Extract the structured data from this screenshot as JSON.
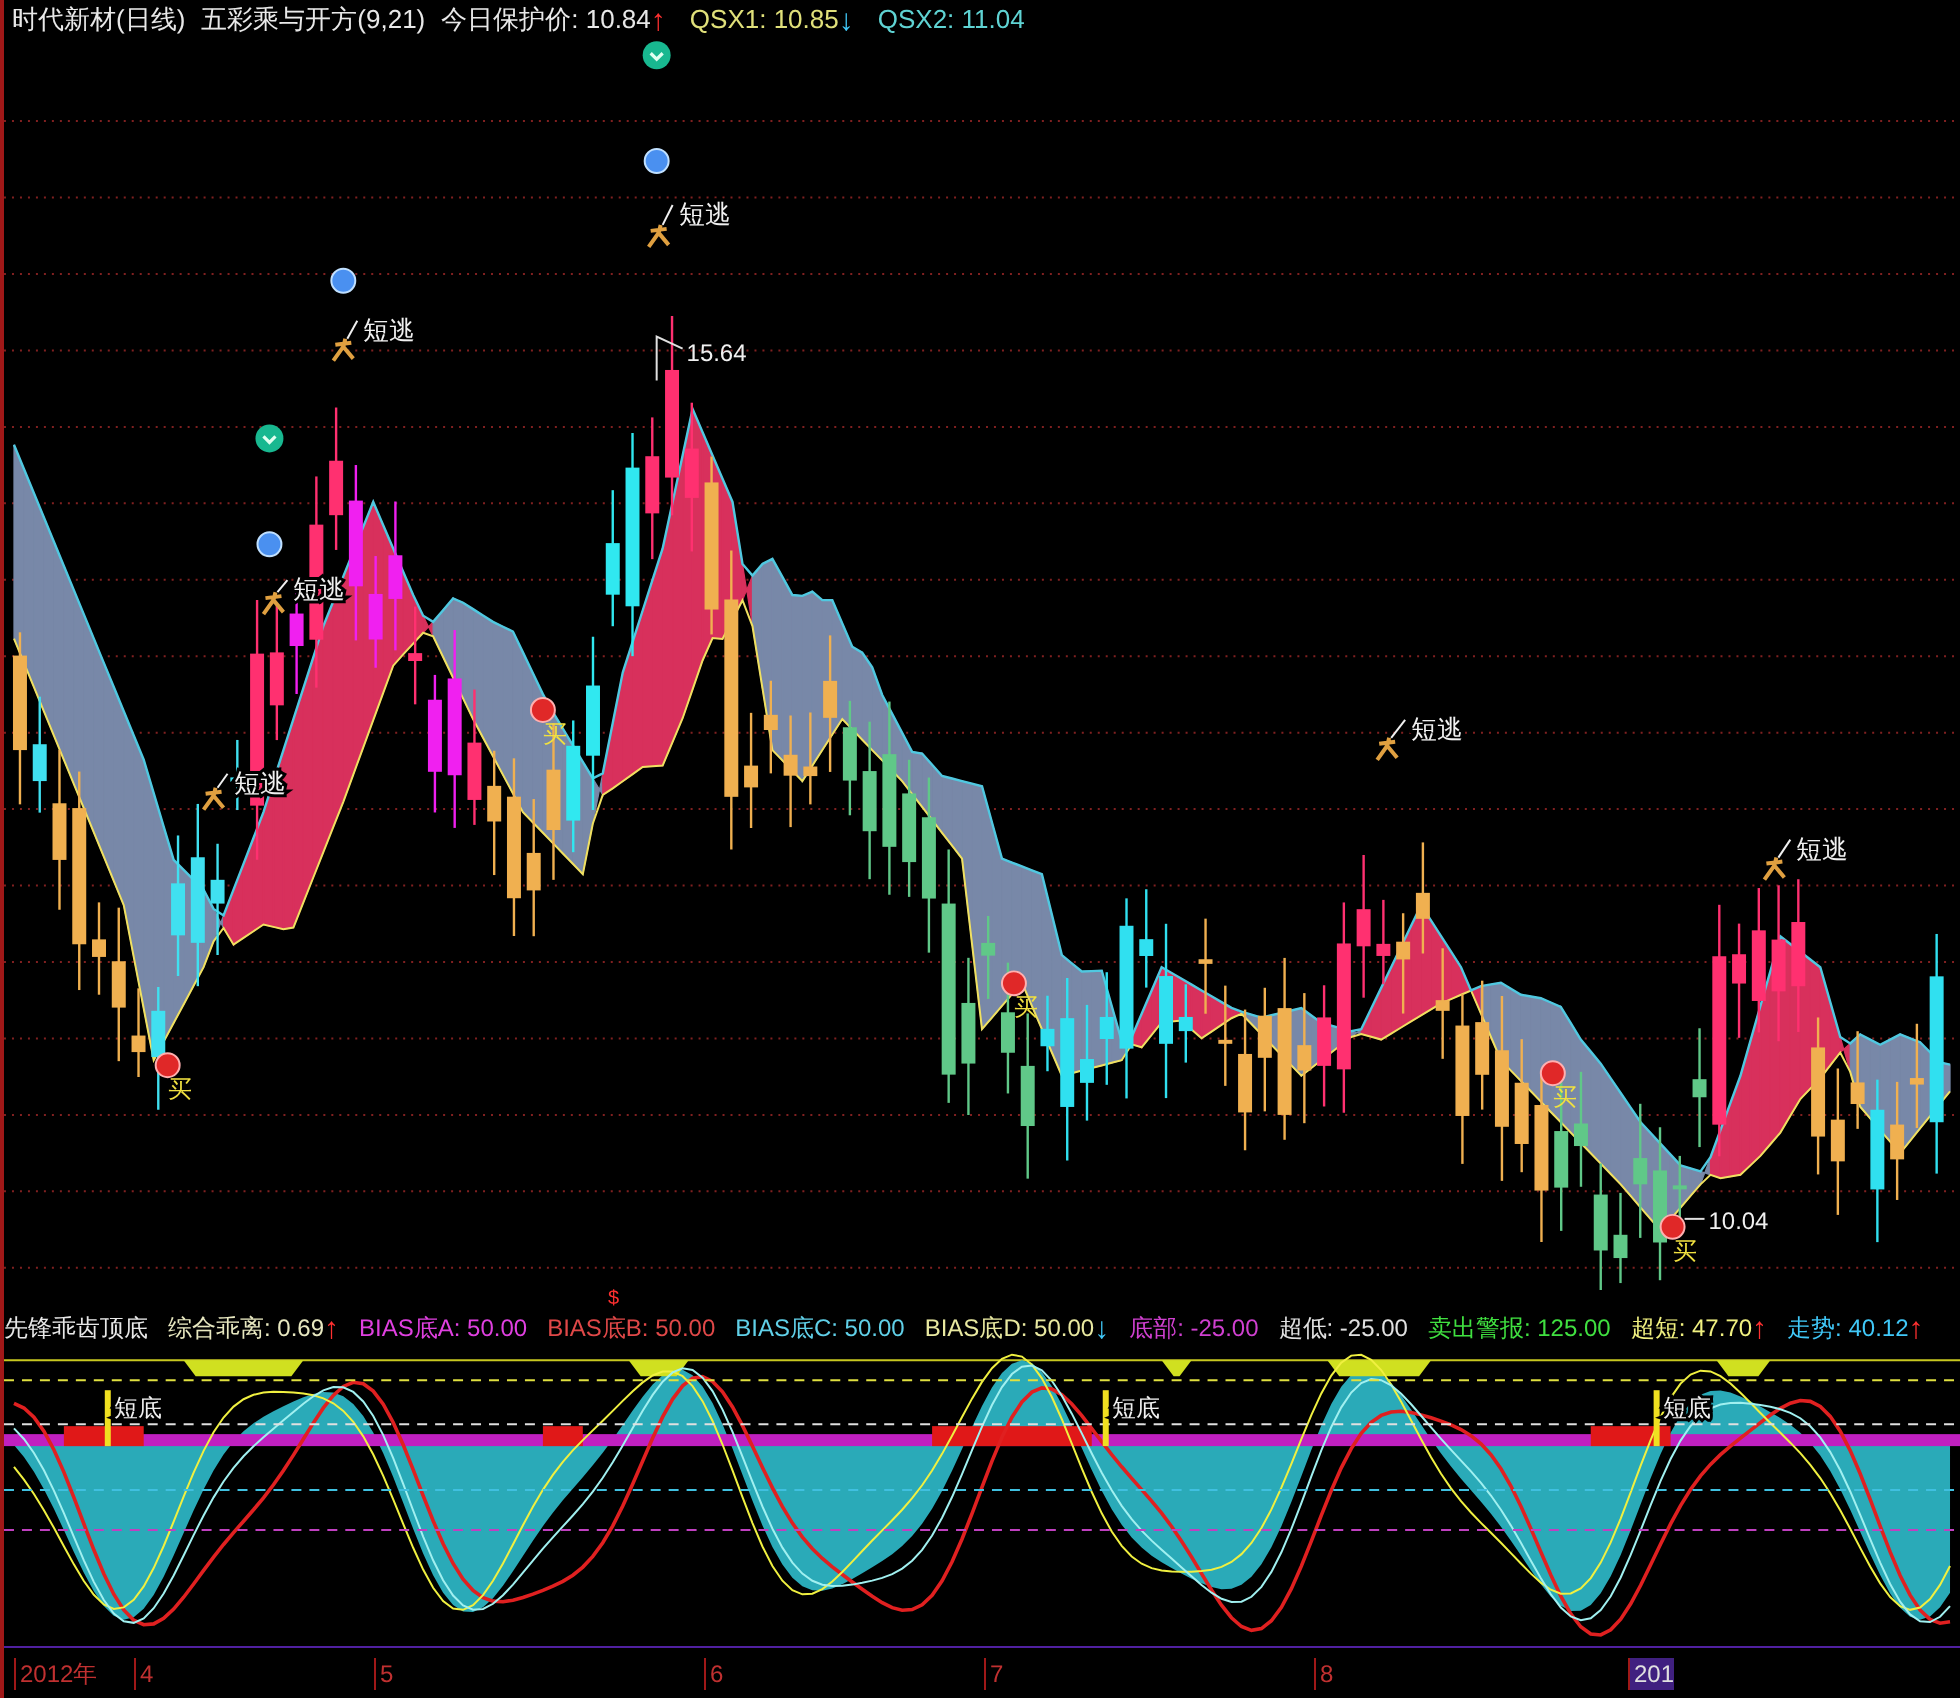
{
  "header": {
    "title": "时代新材(日线)",
    "indicator": "五彩乘与开方(9,21)",
    "readings": [
      {
        "text": "今日保护价: 10.84",
        "arrow": {
          "text": "↑",
          "color": "#ff3030"
        },
        "color": "#e8e8e8"
      },
      {
        "text": "QSX1: 10.85",
        "arrow": {
          "text": "↓",
          "color": "#40c8f8"
        },
        "color": "#e0e07a"
      },
      {
        "text": "QSX2: 11.04",
        "color": "#5fd3d3"
      }
    ]
  },
  "main_chart": {
    "annotations": [
      {
        "kind": "escape",
        "text": "短逃"
      },
      {
        "kind": "escape",
        "text": "短逃"
      },
      {
        "kind": "escape",
        "text": "短逃"
      },
      {
        "kind": "escape",
        "text": "短逃"
      },
      {
        "kind": "escape",
        "text": "短逃"
      },
      {
        "kind": "escape",
        "text": "短逃"
      },
      {
        "kind": "buy",
        "text": "买"
      },
      {
        "kind": "buy",
        "text": "买"
      },
      {
        "kind": "buy",
        "text": "买"
      },
      {
        "kind": "buy",
        "text": "买"
      },
      {
        "kind": "buy",
        "text": "买"
      },
      {
        "kind": "high",
        "text": "15.64"
      },
      {
        "kind": "low",
        "text": "10.04"
      }
    ]
  },
  "indicator_panel": {
    "title": "先锋乖齿顶底",
    "marker": "$",
    "readings": [
      {
        "text": "综合乖离: 0.69",
        "arrow": {
          "text": "↑",
          "color": "#ff3030"
        },
        "color": "#e8e8c0"
      },
      {
        "text": "BIAS底A: 50.00",
        "color": "#e040e0"
      },
      {
        "text": "BIAS底B: 50.00",
        "color": "#e04848"
      },
      {
        "text": "BIAS底C: 50.00",
        "color": "#60d0e8"
      },
      {
        "text": "BIAS底D: 50.00",
        "arrow": {
          "text": "↓",
          "color": "#40c8f8"
        },
        "color": "#e8e8a0"
      },
      {
        "text": "底部: -25.00",
        "color": "#d040d0"
      },
      {
        "text": "超低: -25.00",
        "color": "#e0e0e0"
      },
      {
        "text": "卖出警报: 125.00",
        "color": "#40e040"
      },
      {
        "text": "超短: 47.70",
        "arrow": {
          "text": "↑",
          "color": "#ff3030"
        },
        "color": "#f0f080"
      },
      {
        "text": "走势: 40.12",
        "arrow": {
          "text": "↑",
          "color": "#ff3030"
        },
        "color": "#40c8f8"
      }
    ],
    "labels": [
      "短底",
      "短底",
      "短底"
    ]
  },
  "date_axis": [
    "2012年",
    "4",
    "5",
    "6",
    "7",
    "8",
    "201"
  ]
}
